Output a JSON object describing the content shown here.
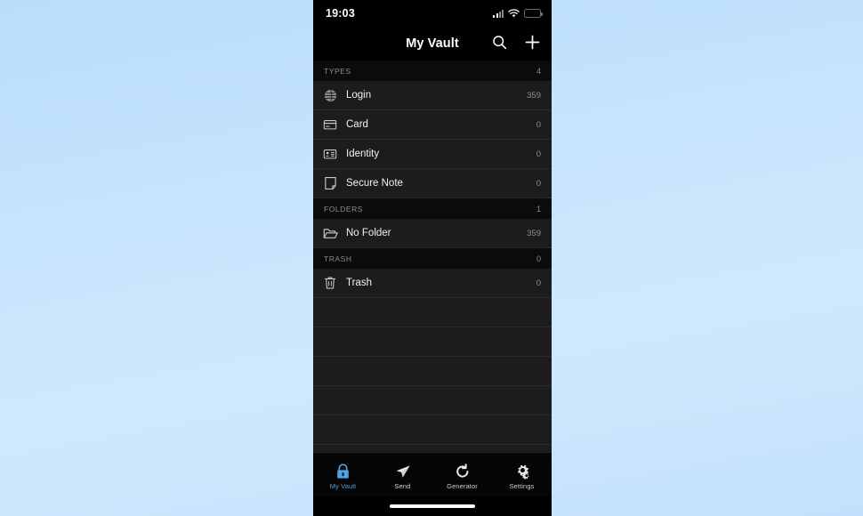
{
  "theme": {
    "page_background_top": "#b9ddfb",
    "page_background_bottom": "#c3e1fc",
    "app_background": "#000000",
    "list_row_background": "#1c1c1e",
    "section_header_background": "#0b0b0c",
    "accent": "#4ea4e0",
    "secondary_text": "#8e8e93",
    "battery_low": "#e8392e"
  },
  "status_bar": {
    "time": "19:03",
    "cellular_icon": "cellular-signal-icon",
    "wifi_icon": "wifi-icon",
    "battery_icon": "battery-low-icon",
    "battery_level_percent": 22
  },
  "navbar": {
    "title": "My Vault",
    "search_icon": "search-icon",
    "add_icon": "plus-icon"
  },
  "sections": [
    {
      "id": "types",
      "header": "TYPES",
      "count": "4",
      "rows": [
        {
          "icon": "globe-icon",
          "label": "Login",
          "count": "359"
        },
        {
          "icon": "credit-card-icon",
          "label": "Card",
          "count": "0"
        },
        {
          "icon": "id-card-icon",
          "label": "Identity",
          "count": "0"
        },
        {
          "icon": "note-icon",
          "label": "Secure Note",
          "count": "0"
        }
      ]
    },
    {
      "id": "folders",
      "header": "FOLDERS",
      "count": "1",
      "rows": [
        {
          "icon": "folder-open-icon",
          "label": "No Folder",
          "count": "359"
        }
      ]
    },
    {
      "id": "trash",
      "header": "TRASH",
      "count": "0",
      "rows": [
        {
          "icon": "trash-icon",
          "label": "Trash",
          "count": "0"
        }
      ]
    }
  ],
  "tabbar": {
    "items": [
      {
        "id": "my-vault",
        "label": "My Vault",
        "icon": "lock-icon",
        "active": true
      },
      {
        "id": "send",
        "label": "Send",
        "icon": "send-paper-plane-icon",
        "active": false
      },
      {
        "id": "generator",
        "label": "Generator",
        "icon": "refresh-icon",
        "active": false
      },
      {
        "id": "settings",
        "label": "Settings",
        "icon": "gears-icon",
        "active": false
      }
    ]
  },
  "home_indicator": "home-indicator-bar"
}
